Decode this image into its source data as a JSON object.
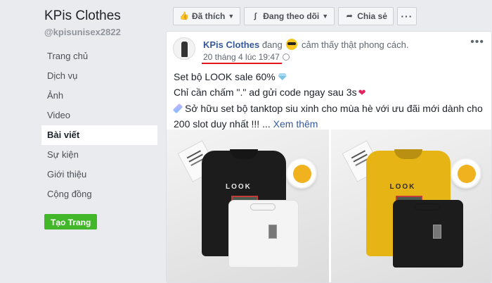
{
  "page": {
    "name": "KPis Clothes",
    "handle": "@kpisunisex2822"
  },
  "sidebar": {
    "items": [
      {
        "label": "Trang chủ",
        "active": false
      },
      {
        "label": "Dịch vụ",
        "active": false
      },
      {
        "label": "Ảnh",
        "active": false
      },
      {
        "label": "Video",
        "active": false
      },
      {
        "label": "Bài viết",
        "active": true
      },
      {
        "label": "Sự kiện",
        "active": false
      },
      {
        "label": "Giới thiệu",
        "active": false
      },
      {
        "label": "Cộng đồng",
        "active": false
      }
    ],
    "create_page_label": "Tạo Trang"
  },
  "actions": {
    "liked_label": "Đã thích",
    "following_label": "Đang theo dõi",
    "share_label": "Chia sẻ",
    "more_label": "···"
  },
  "post": {
    "author": "KPis Clothes",
    "feeling_prefix": "đang",
    "feeling_text": "cảm thấy thật phong cách.",
    "timestamp": "20 tháng 4 lúc 19:47",
    "more_label": "•••",
    "lines": [
      "Set bộ LOOK sale 60%",
      "Chỉ cần chấm \".\" ad gửi code ngay sau 3s"
    ],
    "line3": "Sở hữu set bộ tanktop siu xinh cho mùa hè với ưu đãi mới dành cho 200 slot duy nhất !!! ...",
    "see_more": "Xem thêm",
    "photos": [
      {
        "shirt_color": "#1c1c1c",
        "shirt_text": "LOOK",
        "shorts_color": "#f4f4f4"
      },
      {
        "shirt_color": "#e7b416",
        "shirt_text": "LOOK",
        "shorts_color": "#1c1c1c"
      }
    ]
  },
  "colors": {
    "link": "#365899",
    "create_button": "#42b72a",
    "timestamp_underline": "#e2161b",
    "background": "#e9ebee"
  },
  "icons": {
    "liked": "thumbs-up-icon",
    "following": "rss-icon",
    "share": "share-arrow-icon",
    "feeling": "sunglasses-emoji-icon",
    "privacy": "globe-icon"
  }
}
